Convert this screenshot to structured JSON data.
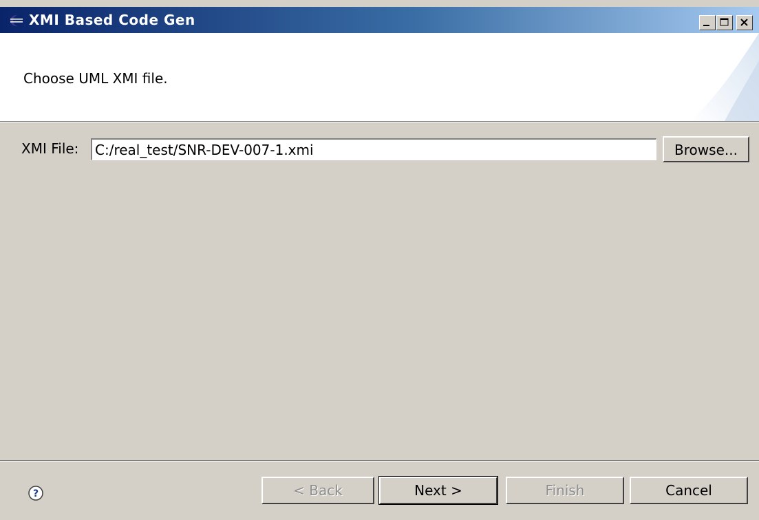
{
  "window": {
    "title": "XMI Based Code Gen",
    "accent": "#0a246a"
  },
  "header": {
    "message": "Choose UML XMI file."
  },
  "form": {
    "field_label": "XMI File:",
    "field_value": "C:/real_test/SNR-DEV-007-1.xmi",
    "browse_label": "Browse..."
  },
  "footer": {
    "help_icon": "help-icon",
    "back": {
      "label": "< Back",
      "enabled": false
    },
    "next": {
      "label": "Next >",
      "enabled": true
    },
    "finish": {
      "label": "Finish",
      "enabled": false
    },
    "cancel": {
      "label": "Cancel",
      "enabled": true
    }
  }
}
